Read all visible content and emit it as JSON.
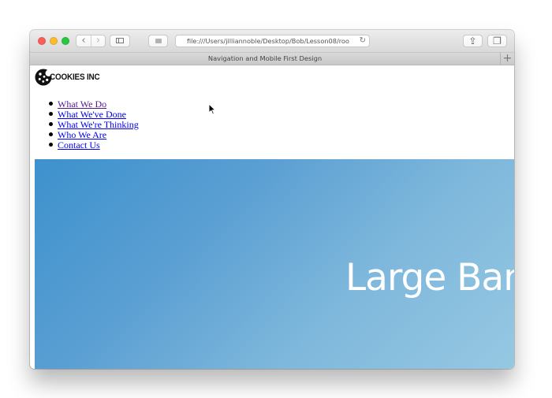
{
  "browser": {
    "address_text": "file:///Users/jilliannoble/Desktop/Bob/Lesson08/roo",
    "tab_title": "Navigation and Mobile First Design",
    "buttons": {
      "back_glyph": "‹",
      "forward_glyph": "›",
      "reload_glyph": "↻",
      "share_glyph": "⇪",
      "tabs_glyph": "❐",
      "new_tab_glyph": "+"
    },
    "icons": {
      "close": "traffic-light-close",
      "minimize": "traffic-light-minimize",
      "maximize": "traffic-light-maximize",
      "sidebar": "sidebar-icon",
      "reader": "reader-icon",
      "share": "share-icon",
      "tabs": "tabs-icon"
    }
  },
  "site": {
    "logo_text": "COOKIES INC",
    "nav_items": [
      {
        "label": "What We Do",
        "visited": true
      },
      {
        "label": "What We've Done",
        "visited": false
      },
      {
        "label": "What We're Thinking",
        "visited": false
      },
      {
        "label": "Who We Are",
        "visited": false
      },
      {
        "label": "Contact Us",
        "visited": false
      }
    ],
    "banner_text": "Large Ban"
  },
  "colors": {
    "link": "#0000ee",
    "visited_link": "#551a8b",
    "banner_start": "#3d91cd",
    "banner_end": "#96c8e2",
    "traffic_close": "#fc5f57",
    "traffic_minimize": "#fdbc2e",
    "traffic_maximize": "#27c840"
  }
}
